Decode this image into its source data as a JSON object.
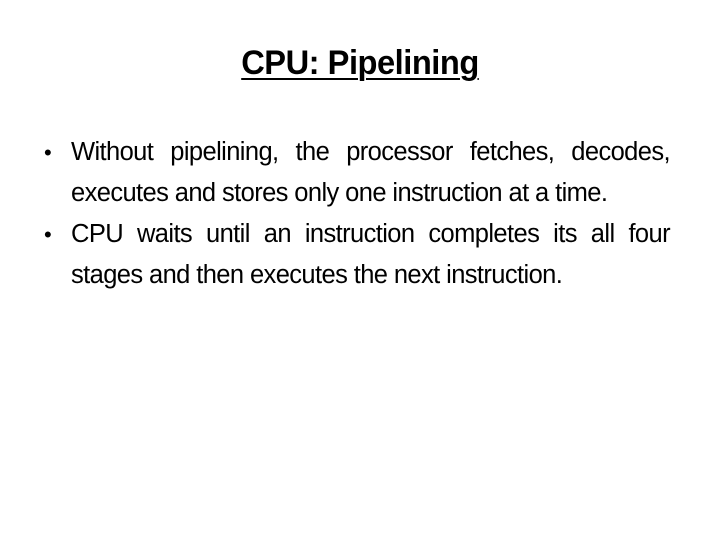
{
  "slide": {
    "title": "CPU: Pipelining",
    "bullets": [
      {
        "icon": "bullet-dot",
        "text": "Without pipelining, the processor fetches, decodes, executes and stores only one instruction at a time."
      },
      {
        "icon": "bullet-dot",
        "text": "CPU waits until an instruction completes its all four stages and then executes the next instruction."
      }
    ]
  }
}
